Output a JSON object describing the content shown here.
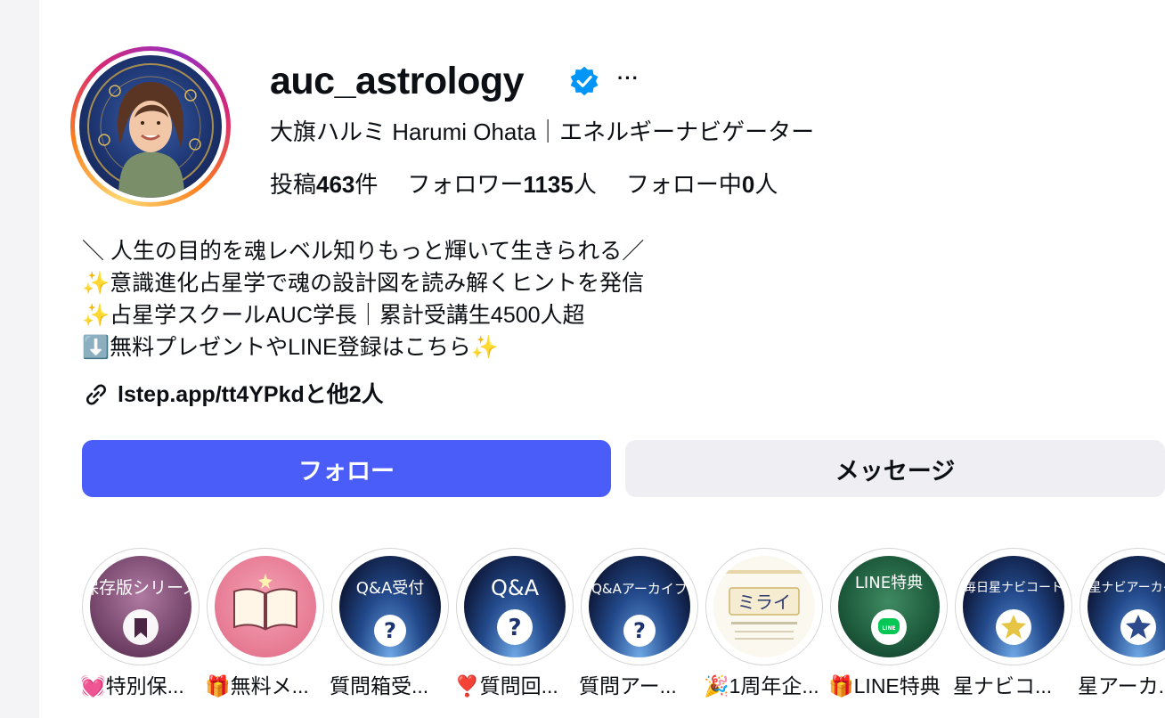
{
  "profile": {
    "username": "auc_astrology",
    "verified_icon": "verified-badge-icon",
    "more_label": "···",
    "full_name": "大旗ハルミ Harumi Ohata｜エネルギーナビゲーター"
  },
  "stats": {
    "posts_prefix": "投稿",
    "posts_count": "463",
    "posts_suffix": "件",
    "followers_prefix": "フォロワー",
    "followers_count": "1135",
    "followers_suffix": "人",
    "following_prefix": "フォロー中",
    "following_count": "0",
    "following_suffix": "人"
  },
  "bio": {
    "line1": "＼ 人生の目的を魂レベル知りもっと輝いて生きられる／",
    "line2": "✨意識進化占星学で魂の設計図を読み解くヒントを発信",
    "line3": "✨占星学スクールAUC学長｜累計受講生4500人超",
    "line4": "⬇️無料プレゼントやLINE登録はこちら✨"
  },
  "link": {
    "text": "lstep.app/tt4YPkdと他2人"
  },
  "buttons": {
    "follow": "フォロー",
    "message": "メッセージ"
  },
  "highlights": [
    {
      "label": "💓特別保...",
      "cover_text": "保存版シリーズ",
      "icon": "bookmark-icon"
    },
    {
      "label": "🎁無料メ...",
      "cover_text": "",
      "icon": "open-book-icon"
    },
    {
      "label": "質問箱受...",
      "cover_text": "Q&A受付",
      "icon": "question-icon"
    },
    {
      "label": "❣️質問回...",
      "cover_text": "Q&A",
      "icon": "question-icon"
    },
    {
      "label": "質問アー...",
      "cover_text": "Q&Aアーカイブ",
      "icon": "question-icon"
    },
    {
      "label": "🎉1周年企...",
      "cover_text": "ミライ",
      "icon": "document-icon"
    },
    {
      "label": "🎁LINE特典",
      "cover_text": "LINE特典",
      "icon": "line-app-icon"
    },
    {
      "label": "星ナビコ...",
      "cover_text": "毎日星ナビコード",
      "icon": "star-icon"
    },
    {
      "label": "星アーカ...",
      "cover_text": "星ナビアーカイブ",
      "icon": "star-icon"
    }
  ],
  "colors": {
    "follow_button": "#4a5df9",
    "message_button": "#efeff3",
    "verified_blue": "#0095f6"
  }
}
